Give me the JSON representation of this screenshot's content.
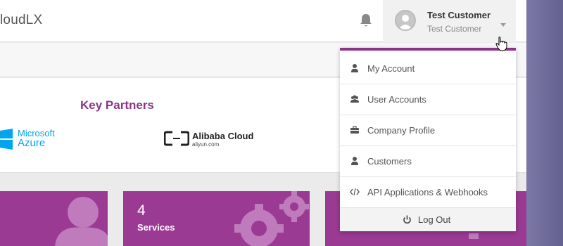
{
  "header": {
    "brand": "loudLX",
    "user": {
      "name": "Test Customer",
      "subtitle": "Test Customer"
    }
  },
  "partners": {
    "title": "Key Partners",
    "logos": [
      {
        "name": "Microsoft",
        "name2": "Azure"
      },
      {
        "name": "Alibaba Cloud",
        "sub": "aliyun.com"
      }
    ]
  },
  "tiles": [
    {
      "number": "",
      "label": ""
    },
    {
      "number": "4",
      "label": "Services"
    },
    {
      "number": "",
      "label": ""
    }
  ],
  "dropdown": {
    "items": [
      {
        "label": "My Account",
        "icon": "user-icon"
      },
      {
        "label": "User Accounts",
        "icon": "users-icon"
      },
      {
        "label": "Company Profile",
        "icon": "briefcase-icon"
      },
      {
        "label": "Customers",
        "icon": "user-icon"
      },
      {
        "label": "API Applications & Webhooks",
        "icon": "code-icon"
      }
    ],
    "logout": {
      "label": "Log Out",
      "icon": "power-icon"
    }
  },
  "colors": {
    "accent": "#8b3589",
    "tile": "#9a3a93"
  }
}
